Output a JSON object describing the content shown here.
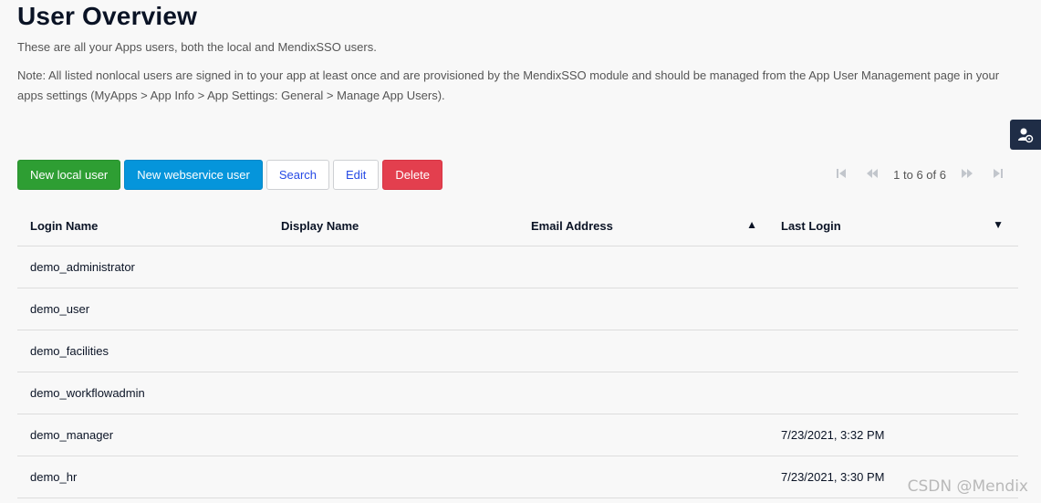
{
  "page": {
    "title": "User Overview",
    "intro": "These are all your Apps users, both the local and MendixSSO users.",
    "note": "Note: All listed nonlocal users are signed in to your app at least once and are provisioned by the MendixSSO module and should be managed from the App User Management page in your apps settings (MyApps > App Info > App Settings: General > Manage App Users)."
  },
  "side_widget": {
    "icon": "user-settings-icon"
  },
  "toolbar": {
    "new_local_user": "New local user",
    "new_webservice_user": "New webservice user",
    "search": "Search",
    "edit": "Edit",
    "delete": "Delete"
  },
  "pager": {
    "status": "1 to 6 of 6",
    "first_icon": "first-page-icon",
    "prev_icon": "previous-page-icon",
    "next_icon": "next-page-icon",
    "last_icon": "last-page-icon"
  },
  "colors": {
    "success": "#2e9e33",
    "primary": "#0595db",
    "danger": "#e33f4e",
    "link": "#264ae5"
  },
  "grid": {
    "columns": [
      "Login Name",
      "Display Name",
      "Email Address",
      "Last Login"
    ],
    "sort": {
      "email_indicator": "▲",
      "last_login_indicator": "▼"
    },
    "rows": [
      {
        "login": "demo_administrator",
        "display": "",
        "email": "",
        "last_login": ""
      },
      {
        "login": "demo_user",
        "display": "",
        "email": "",
        "last_login": ""
      },
      {
        "login": "demo_facilities",
        "display": "",
        "email": "",
        "last_login": ""
      },
      {
        "login": "demo_workflowadmin",
        "display": "",
        "email": "",
        "last_login": ""
      },
      {
        "login": "demo_manager",
        "display": "",
        "email": "",
        "last_login": "7/23/2021, 3:32 PM"
      },
      {
        "login": "demo_hr",
        "display": "",
        "email": "",
        "last_login": "7/23/2021, 3:30 PM"
      }
    ]
  },
  "watermark": "CSDN @Mendix"
}
